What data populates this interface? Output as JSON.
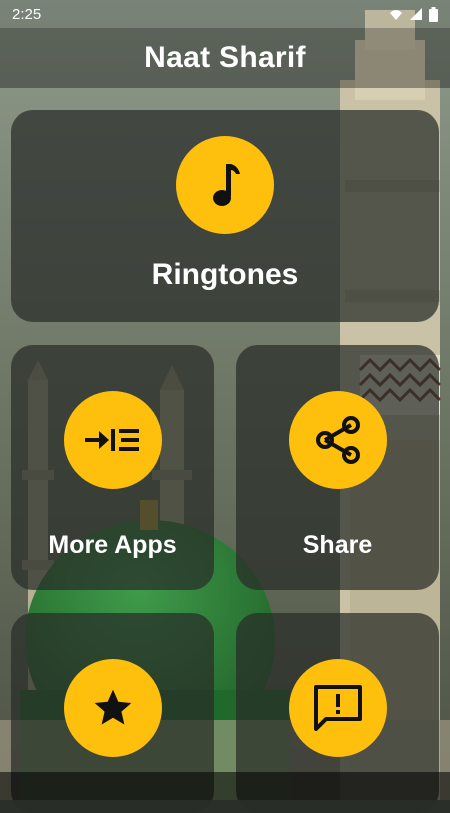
{
  "status_bar": {
    "time": "2:25"
  },
  "app_bar": {
    "title": "Naat Sharif"
  },
  "cards": {
    "ringtones": {
      "label": "Ringtones",
      "icon": "music-note-icon"
    },
    "more_apps": {
      "label": "More Apps",
      "icon": "more-apps-icon"
    },
    "share": {
      "label": "Share",
      "icon": "share-icon"
    },
    "rate": {
      "icon": "star-icon"
    },
    "feedback": {
      "icon": "feedback-icon"
    }
  },
  "colors": {
    "accent": "#FFBF0D",
    "card_bg": "rgba(40,45,40,0.72)",
    "text": "#FFFFFF"
  }
}
